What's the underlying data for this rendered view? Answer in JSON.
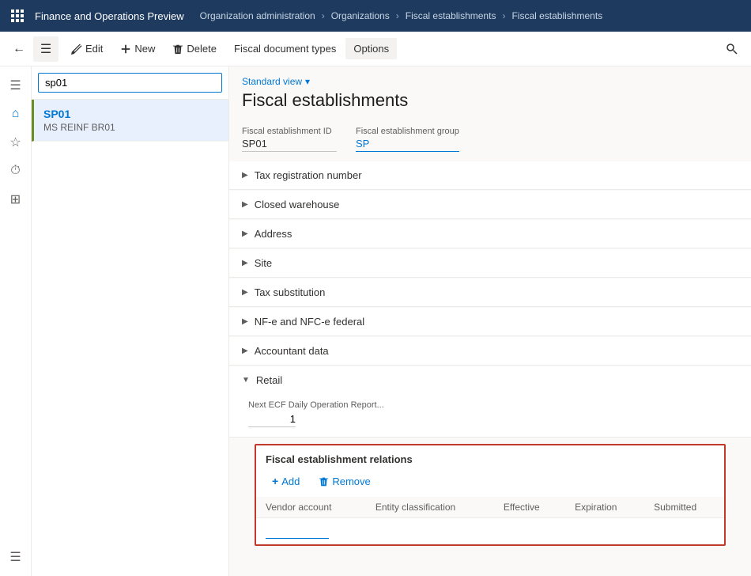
{
  "app": {
    "title": "Finance and Operations Preview"
  },
  "breadcrumb": {
    "items": [
      "Organization administration",
      "Organizations",
      "Fiscal establishments",
      "Fiscal establishments"
    ]
  },
  "toolbar": {
    "back_label": "←",
    "hamburger_label": "≡",
    "edit_label": "Edit",
    "new_label": "New",
    "delete_label": "Delete",
    "fiscal_doc_label": "Fiscal document types",
    "options_label": "Options",
    "search_label": "🔍"
  },
  "sidebar_icons": [
    {
      "name": "menu-icon",
      "glyph": "☰"
    },
    {
      "name": "home-icon",
      "glyph": "⌂"
    },
    {
      "name": "star-icon",
      "glyph": "☆"
    },
    {
      "name": "history-icon",
      "glyph": "⏱"
    },
    {
      "name": "workspaces-icon",
      "glyph": "⊞"
    },
    {
      "name": "list-icon",
      "glyph": "☰"
    }
  ],
  "list_panel": {
    "search_placeholder": "sp01",
    "items": [
      {
        "id": "SP01",
        "subtitle": "MS REINF BR01",
        "selected": true
      }
    ]
  },
  "detail": {
    "standard_view": "Standard view",
    "page_title": "Fiscal establishments",
    "fields": {
      "id_label": "Fiscal establishment ID",
      "id_value": "SP01",
      "group_label": "Fiscal establishment group",
      "group_value": "SP"
    },
    "sections": [
      {
        "label": "Tax registration number",
        "expanded": false
      },
      {
        "label": "Closed warehouse",
        "expanded": false
      },
      {
        "label": "Address",
        "expanded": false
      },
      {
        "label": "Site",
        "expanded": false
      },
      {
        "label": "Tax substitution",
        "expanded": false
      },
      {
        "label": "NF-e and NFC-e federal",
        "expanded": false
      },
      {
        "label": "Accountant data",
        "expanded": false
      },
      {
        "label": "Retail",
        "expanded": true
      }
    ],
    "retail": {
      "field_label": "Next ECF Daily Operation Report...",
      "field_value": "1"
    },
    "fiscal_relations": {
      "title": "Fiscal establishment relations",
      "add_label": "Add",
      "remove_label": "Remove",
      "columns": [
        "Vendor account",
        "Entity classification",
        "Effective",
        "Expiration",
        "Submitted"
      ]
    }
  }
}
